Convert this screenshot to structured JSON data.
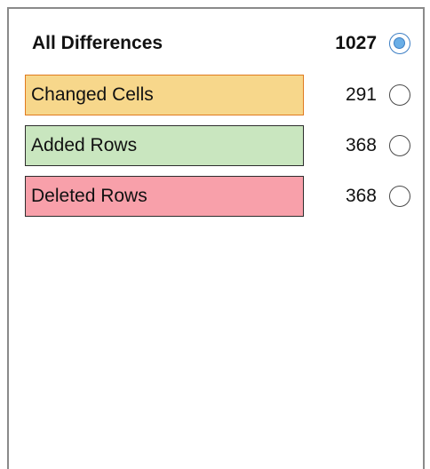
{
  "filters": [
    {
      "id": "all",
      "label": "All Differences",
      "count": "1027",
      "selected": true,
      "color": "#ffffff"
    },
    {
      "id": "changed",
      "label": "Changed Cells",
      "count": "291",
      "selected": false,
      "color": "#f7d78b"
    },
    {
      "id": "added",
      "label": "Added Rows",
      "count": "368",
      "selected": false,
      "color": "#c9e6bf"
    },
    {
      "id": "deleted",
      "label": "Deleted Rows",
      "count": "368",
      "selected": false,
      "color": "#f8a0aa"
    }
  ]
}
